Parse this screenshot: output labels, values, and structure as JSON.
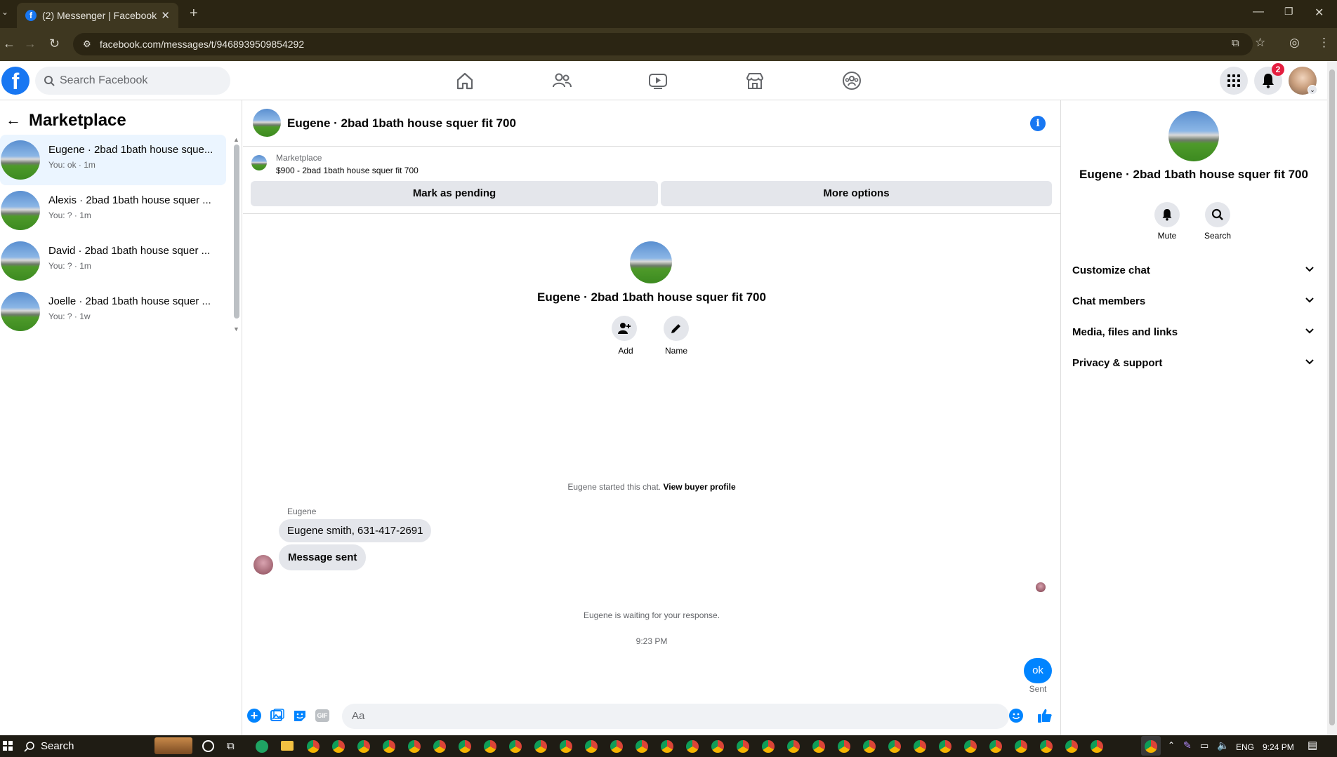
{
  "browser": {
    "tab_title": "(2) Messenger | Facebook",
    "url": "facebook.com/messages/t/9468939509854292"
  },
  "header": {
    "search_placeholder": "Search Facebook",
    "notification_count": "2"
  },
  "left": {
    "title": "Marketplace",
    "conversations": [
      {
        "name": "Eugene · 2bad 1bath house sque...",
        "sub": "You: ok · 1m"
      },
      {
        "name": "Alexis · 2bad 1bath house squer ...",
        "sub": "You: ? · 1m"
      },
      {
        "name": "David · 2bad 1bath house squer ...",
        "sub": "You: ? · 1m"
      },
      {
        "name": "Joelle · 2bad 1bath house squer ...",
        "sub": "You: ? · 1w"
      }
    ]
  },
  "chat": {
    "title": "Eugene · 2bad 1bath house squer fit 700",
    "marketplace_label": "Marketplace",
    "listing": "$900 - 2bad 1bath house squer fit 700",
    "mark_pending": "Mark as pending",
    "more_options": "More options",
    "profile_name": "Eugene · 2bad 1bath house squer fit 700",
    "add_label": "Add",
    "name_label": "Name",
    "started_text": "Eugene started this chat.",
    "view_buyer": "View buyer profile",
    "sender": "Eugene",
    "msg1": "Eugene smith, 631-417-2691",
    "msg2": "Message sent",
    "waiting": "Eugene is waiting for your response.",
    "time": "9:23 PM",
    "my_msg": "ok",
    "sent": "Sent",
    "composer_placeholder": "Aa",
    "gif_label": "GIF"
  },
  "right": {
    "name": "Eugene · 2bad 1bath house squer fit 700",
    "mute": "Mute",
    "search": "Search",
    "sections": [
      "Customize chat",
      "Chat members",
      "Media, files and links",
      "Privacy & support"
    ]
  },
  "taskbar": {
    "search": "Search",
    "lang": "ENG",
    "clock": "9:24 PM"
  },
  "colors": {
    "brand": "#1877f2",
    "chrome_bg": "#2b2513",
    "badge": "#e41e3f"
  }
}
